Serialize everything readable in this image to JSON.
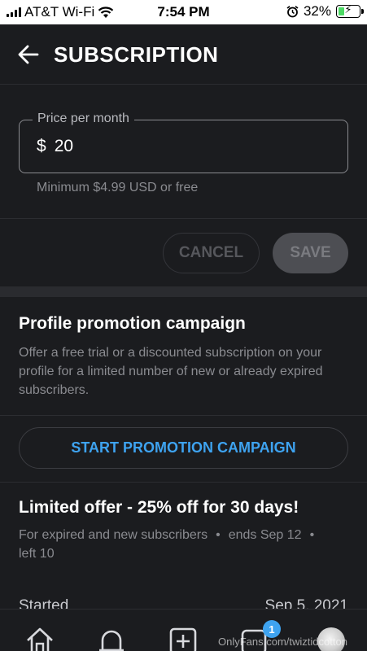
{
  "status_bar": {
    "carrier": "AT&T Wi-Fi",
    "time": "7:54 PM",
    "battery_percent": "32%",
    "battery_level": 0.32,
    "battery_color": "#4cd964"
  },
  "header": {
    "back_icon": "arrow-left-icon",
    "title": "SUBSCRIPTION"
  },
  "price": {
    "label": "Price per month",
    "currency": "$",
    "value": "20",
    "hint": "Minimum $4.99 USD or free"
  },
  "actions": {
    "cancel_label": "CANCEL",
    "save_label": "SAVE"
  },
  "promotion": {
    "title": "Profile promotion campaign",
    "description": "Offer a free trial or a discounted subscription on your profile for a limited number of new or already expired subscribers.",
    "button_label": "START PROMOTION CAMPAIGN"
  },
  "offer": {
    "title": "Limited offer - 25% off for 30 days!",
    "audience": "For expired and new subscribers",
    "ends": "ends Sep 12",
    "left": "left 10",
    "separator": "•"
  },
  "started": {
    "label": "Started",
    "date": "Sep 5, 2021"
  },
  "bottom_nav": {
    "items": [
      "home-icon",
      "bell-icon",
      "plus-square-icon",
      "messages-icon",
      "avatar"
    ],
    "messages_badge": "1",
    "watermark": "OnlyFans.com/twiztidcotton"
  },
  "colors": {
    "background": "#1b1c1f",
    "accent": "#3ea3f0",
    "muted_text": "#8a8b90"
  }
}
